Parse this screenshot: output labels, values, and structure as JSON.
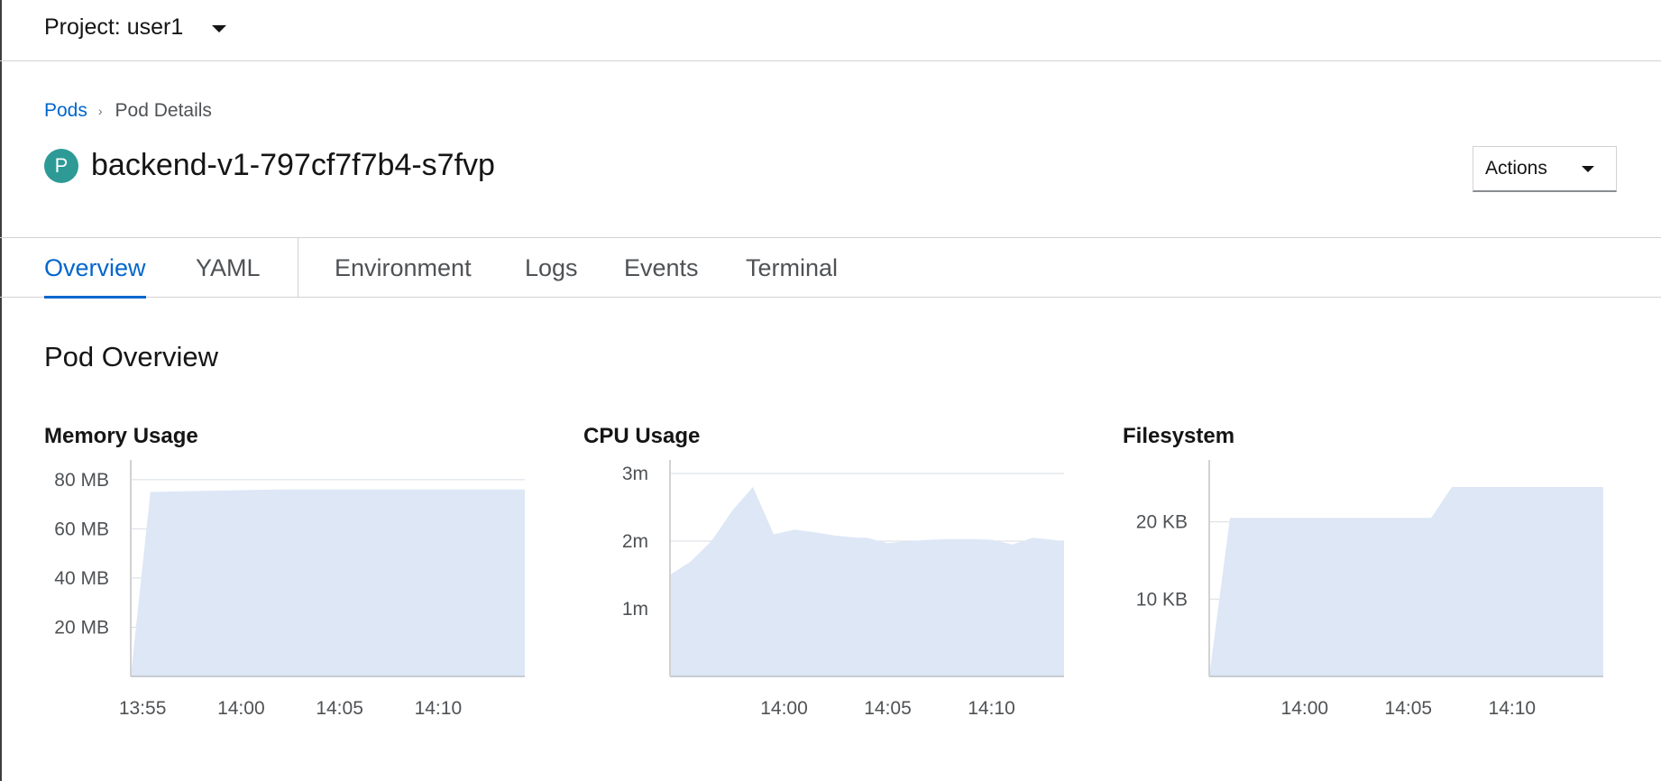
{
  "project_bar": {
    "label": "Project: user1"
  },
  "breadcrumb": {
    "parent": "Pods",
    "separator": "›",
    "current": "Pod Details"
  },
  "resource": {
    "badge": "P",
    "name": "backend-v1-797cf7f7b4-s7fvp"
  },
  "actions": {
    "label": "Actions"
  },
  "tabs": [
    {
      "label": "Overview",
      "active": true
    },
    {
      "label": "YAML",
      "active": false
    },
    {
      "label": "Environment",
      "active": false
    },
    {
      "label": "Logs",
      "active": false
    },
    {
      "label": "Events",
      "active": false
    },
    {
      "label": "Terminal",
      "active": false
    }
  ],
  "section": {
    "title": "Pod Overview"
  },
  "colors": {
    "accent": "#0066cc",
    "area_fill": "#dde7f6",
    "badge": "#2d9a96"
  },
  "chart_data": [
    {
      "type": "area",
      "title": "Memory Usage",
      "x_ticks": [
        {
          "label": "13:55",
          "t": 0
        },
        {
          "label": "14:00",
          "t": 5
        },
        {
          "label": "14:05",
          "t": 10
        },
        {
          "label": "14:10",
          "t": 15
        }
      ],
      "y_ticks": [
        {
          "label": "20 MB",
          "v": 20
        },
        {
          "label": "40 MB",
          "v": 40
        },
        {
          "label": "60 MB",
          "v": 60
        },
        {
          "label": "80 MB",
          "v": 80
        }
      ],
      "xlim": [
        -0.6,
        19.4
      ],
      "ylim": [
        0,
        88
      ],
      "series": [
        {
          "points": [
            [
              -0.6,
              0
            ],
            [
              0.4,
              75
            ],
            [
              7,
              76
            ],
            [
              19.4,
              76
            ]
          ]
        }
      ]
    },
    {
      "type": "area",
      "title": "CPU Usage",
      "x_ticks": [
        {
          "label": "14:00",
          "t": 5
        },
        {
          "label": "14:05",
          "t": 10
        },
        {
          "label": "14:10",
          "t": 15
        }
      ],
      "y_ticks": [
        {
          "label": "1m",
          "v": 1
        },
        {
          "label": "2m",
          "v": 2
        },
        {
          "label": "3m",
          "v": 3
        }
      ],
      "xlim": [
        -0.5,
        18.5
      ],
      "ylim": [
        0,
        3
      ],
      "series": [
        {
          "points": [
            [
              -0.5,
              1.5
            ],
            [
              0.5,
              1.7
            ],
            [
              1.5,
              2.0
            ],
            [
              2.5,
              2.45
            ],
            [
              3.5,
              2.8
            ],
            [
              4.5,
              2.1
            ],
            [
              5.5,
              2.17
            ],
            [
              6.5,
              2.13
            ],
            [
              7.5,
              2.08
            ],
            [
              8.5,
              2.05
            ],
            [
              9,
              2.05
            ],
            [
              10,
              1.97
            ],
            [
              11,
              2.0
            ],
            [
              12,
              2.02
            ],
            [
              13,
              2.03
            ],
            [
              14,
              2.03
            ],
            [
              15,
              2.02
            ],
            [
              16,
              1.95
            ],
            [
              17,
              2.05
            ],
            [
              18.5,
              2.0
            ]
          ]
        }
      ]
    },
    {
      "type": "area",
      "title": "Filesystem",
      "x_ticks": [
        {
          "label": "14:00",
          "t": 5
        },
        {
          "label": "14:05",
          "t": 10
        },
        {
          "label": "14:10",
          "t": 15
        }
      ],
      "y_ticks": [
        {
          "label": "10 KB",
          "v": 10
        },
        {
          "label": "20 KB",
          "v": 20
        }
      ],
      "xlim": [
        0.4,
        19.4
      ],
      "ylim": [
        0,
        28
      ],
      "series": [
        {
          "points": [
            [
              0.4,
              0
            ],
            [
              1.4,
              20.5
            ],
            [
              11.1,
              20.5
            ],
            [
              12.1,
              24.5
            ],
            [
              19.4,
              24.5
            ]
          ]
        }
      ]
    }
  ]
}
